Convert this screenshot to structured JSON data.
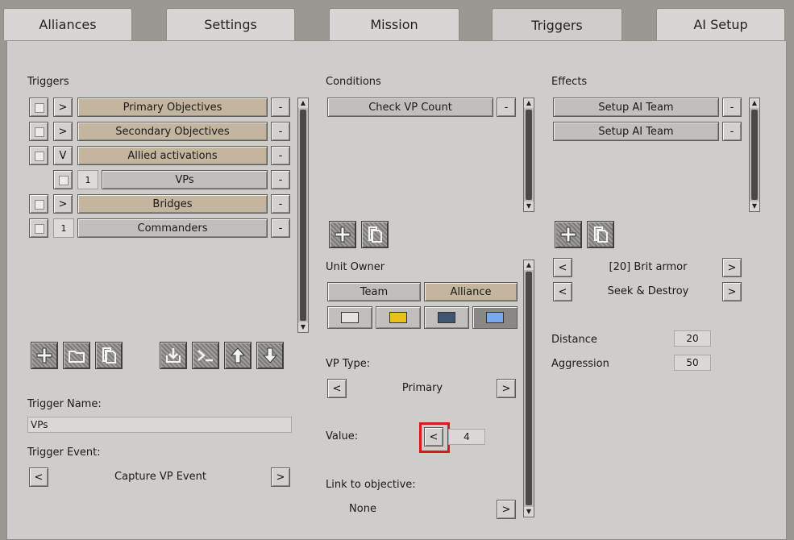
{
  "tabs": [
    {
      "label": "Alliances"
    },
    {
      "label": "Settings"
    },
    {
      "label": "Mission"
    },
    {
      "label": "Triggers"
    },
    {
      "label": "AI Setup"
    }
  ],
  "triggers": {
    "title": "Triggers",
    "items": [
      {
        "expand": ">",
        "label": "Primary Objectives",
        "remove": "-"
      },
      {
        "expand": ">",
        "label": "Secondary Objectives",
        "remove": "-"
      },
      {
        "expand": "V",
        "label": "Allied activations",
        "remove": "-"
      },
      {
        "count": "1",
        "label": "VPs",
        "remove": "-"
      },
      {
        "expand": ">",
        "label": "Bridges",
        "remove": "-"
      },
      {
        "count": "1",
        "label": "Commanders",
        "remove": "-"
      }
    ],
    "name_label": "Trigger Name:",
    "name_value": "VPs",
    "event_label": "Trigger Event:",
    "event_value": "Capture VP Event",
    "prev": "<",
    "next": ">"
  },
  "conditions": {
    "title": "Conditions",
    "items": [
      {
        "label": "Check VP Count",
        "remove": "-"
      }
    ],
    "unit_owner_label": "Unit Owner",
    "team_label": "Team",
    "alliance_label": "Alliance",
    "swatches": [
      "#e4e3e0",
      "#e8c21b",
      "#3f5570",
      "#7aa8ee"
    ],
    "vp_type_label": "VP Type:",
    "vp_type_value": "Primary",
    "value_label": "Value:",
    "value": "4",
    "link_label": "Link to objective:",
    "link_value": "None",
    "prev": "<",
    "next": ">"
  },
  "effects": {
    "title": "Effects",
    "items": [
      {
        "label": "Setup AI Team",
        "remove": "-"
      },
      {
        "label": "Setup AI Team",
        "remove": "-"
      }
    ],
    "team_value": "[20] Brit armor",
    "mode_value": "Seek & Destroy",
    "distance_label": "Distance",
    "distance_value": "20",
    "aggression_label": "Aggression",
    "aggression_value": "50",
    "prev": "<",
    "next": ">"
  },
  "scroll_up": "▲",
  "scroll_down": "▼"
}
